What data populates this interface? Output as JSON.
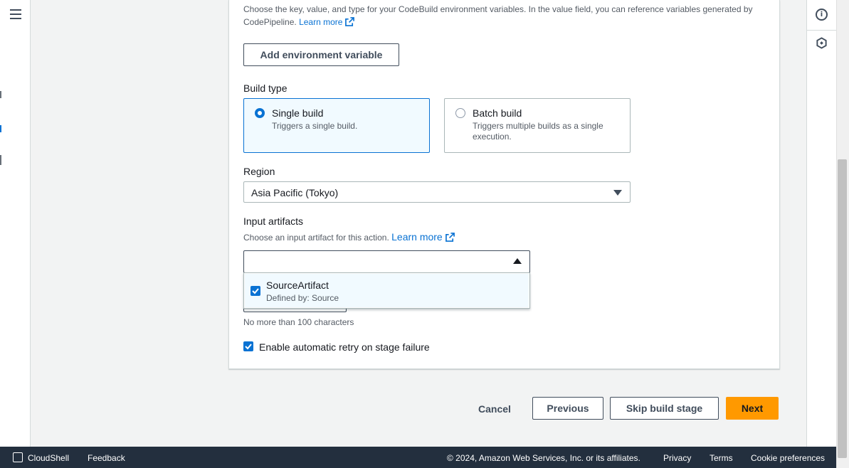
{
  "env_vars": {
    "description_prefix": "Choose the key, value, and type for your CodeBuild environment variables. In the value field, you can reference variables generated by CodePipeline.",
    "learn_more": "Learn more",
    "add_button": "Add environment variable"
  },
  "build_type": {
    "label": "Build type",
    "options": [
      {
        "title": "Single build",
        "description": "Triggers a single build.",
        "selected": true
      },
      {
        "title": "Batch build",
        "description": "Triggers multiple builds as a single execution.",
        "selected": false
      }
    ]
  },
  "region": {
    "label": "Region",
    "value": "Asia Pacific (Tokyo)"
  },
  "input_artifacts": {
    "label": "Input artifacts",
    "description": "Choose an input artifact for this action.",
    "learn_more": "Learn more",
    "value": "",
    "options": [
      {
        "title": "SourceArtifact",
        "subtitle": "Defined by: Source",
        "checked": true
      }
    ]
  },
  "char_constraint": "No more than 100 characters",
  "auto_retry": {
    "label": "Enable automatic retry on stage failure",
    "checked": true
  },
  "actions": {
    "cancel": "Cancel",
    "previous": "Previous",
    "skip": "Skip build stage",
    "next": "Next"
  },
  "footer": {
    "cloudshell": "CloudShell",
    "feedback": "Feedback",
    "copyright": "© 2024, Amazon Web Services, Inc. or its affiliates.",
    "privacy": "Privacy",
    "terms": "Terms",
    "cookies": "Cookie preferences"
  },
  "icons": {
    "menu": "hamburger-menu-icon",
    "info": "info-icon",
    "tools": "hexagon-icon",
    "external": "external-link-icon",
    "caret": "caret-icon",
    "cloudshell": "terminal-icon"
  },
  "colors": {
    "primary_button": "#ff9900",
    "link": "#0972d3",
    "footer_bg": "#232f3e"
  }
}
